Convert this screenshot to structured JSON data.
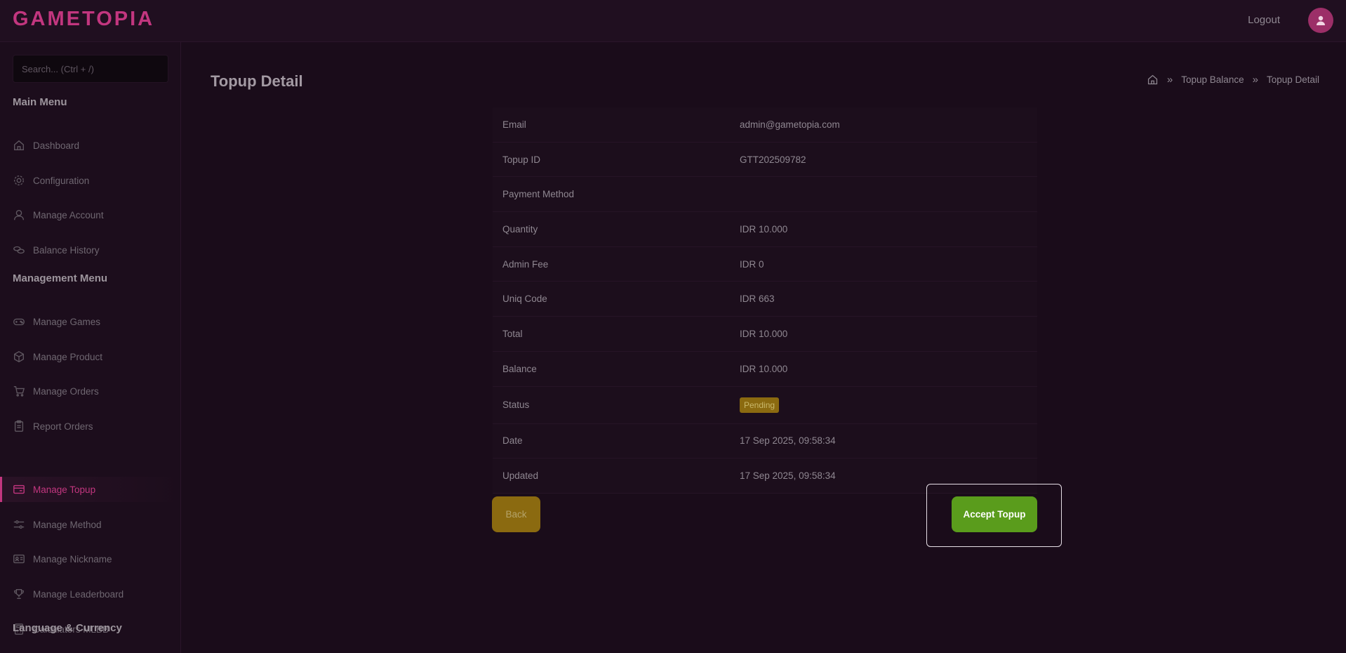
{
  "header": {
    "logo": "GAMETOPIA",
    "logout_label": "Logout"
  },
  "sidebar": {
    "search_placeholder": "Search... (Ctrl + /)",
    "main_menu_title": "Main Menu",
    "main_menu": [
      {
        "label": "Dashboard",
        "icon": "home-icon"
      },
      {
        "label": "Configuration",
        "icon": "gear-icon"
      },
      {
        "label": "Manage Account",
        "icon": "user-icon"
      },
      {
        "label": "Balance History",
        "icon": "coins-icon"
      }
    ],
    "management_menu_title": "Management Menu",
    "management_menu": [
      {
        "label": "Manage Games",
        "icon": "gamepad-icon"
      },
      {
        "label": "Manage Product",
        "icon": "box-icon"
      },
      {
        "label": "Manage Orders",
        "icon": "cart-icon"
      },
      {
        "label": "Report Orders",
        "icon": "clipboard-icon"
      },
      {
        "label": "Manage Topup",
        "icon": "wallet-icon",
        "active": true
      },
      {
        "label": "Manage Method",
        "icon": "sliders-icon"
      },
      {
        "label": "Manage Nickname",
        "icon": "id-card-icon"
      },
      {
        "label": "Manage Leaderboard",
        "icon": "trophy-icon"
      },
      {
        "label": "Calculators MLBB",
        "icon": "calculator-icon"
      }
    ],
    "language_currency_title": "Language & Currency"
  },
  "page": {
    "title": "Topup Detail",
    "breadcrumb": [
      "Topup Balance",
      "Topup Detail"
    ]
  },
  "details": [
    {
      "label": "Email",
      "value": "admin@gametopia.com"
    },
    {
      "label": "Topup ID",
      "value": "GTT202509782"
    },
    {
      "label": "Payment Method",
      "value": ""
    },
    {
      "label": "Quantity",
      "value": "IDR 10.000"
    },
    {
      "label": "Admin Fee",
      "value": "IDR 0"
    },
    {
      "label": "Uniq Code",
      "value": "IDR 663"
    },
    {
      "label": "Total",
      "value": "IDR 10.000"
    },
    {
      "label": "Balance",
      "value": "IDR 10.000"
    },
    {
      "label": "Status",
      "value": "Pending"
    },
    {
      "label": "Date",
      "value": "17 Sep 2025, 09:58:34"
    },
    {
      "label": "Updated",
      "value": "17 Sep 2025, 09:58:34"
    }
  ],
  "actions": {
    "back_label": "Back",
    "accept_label": "Accept Topup"
  },
  "colors": {
    "accent": "#c2367f",
    "background": "#1a0c1a",
    "pending": "#8b6a10",
    "accept": "#5a9c1c"
  }
}
